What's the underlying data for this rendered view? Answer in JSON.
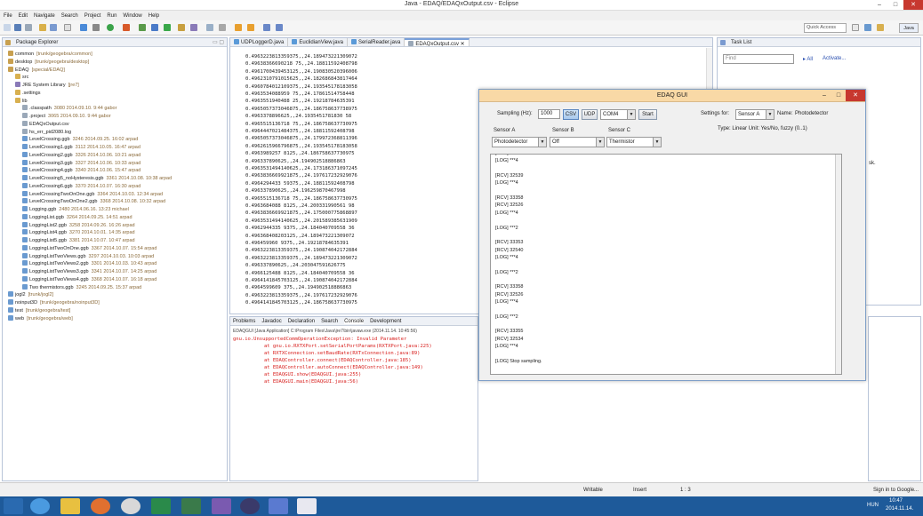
{
  "window": {
    "title": "Java - EDAQ/EDAQxOutput.csv - Eclipse"
  },
  "menu": [
    "File",
    "Edit",
    "Navigate",
    "Search",
    "Project",
    "Run",
    "Window",
    "Help"
  ],
  "quick_access": "Quick Access",
  "perspective": "Java",
  "explorer": {
    "title": "Package Explorer",
    "items": [
      {
        "label": "common",
        "meta": "[trunk/geogebra/common]"
      },
      {
        "label": "desktop",
        "meta": "[trunk/geogebra/desktop]"
      },
      {
        "label": "EDAQ",
        "meta": "[special/EDAQ]"
      },
      {
        "label": "src",
        "meta": ""
      },
      {
        "label": "JRE System Library",
        "meta": "[jre7]"
      },
      {
        "label": ".settings",
        "meta": ""
      },
      {
        "label": "lib",
        "meta": ""
      },
      {
        "label": ".classpath",
        "meta": "3080  2014.09.10. 9:44  gabor"
      },
      {
        "label": ".project",
        "meta": "3065  2014.09.10. 9:44  gabor"
      },
      {
        "label": "EDAQxOutput.csv",
        "meta": ""
      },
      {
        "label": "hs_err_pid2080.log",
        "meta": ""
      },
      {
        "label": "LevelCrossing.ggb",
        "meta": "3246  2014.09.25. 16:02  arpad"
      },
      {
        "label": "LevelCrossing1.ggb",
        "meta": "3112  2014.10.05. 16:47  arpad"
      },
      {
        "label": "LevelCrossing2.ggb",
        "meta": "3326  2014.10.06. 10:21  arpad"
      },
      {
        "label": "LevelCrossing3.ggb",
        "meta": "3327  2014.10.06. 10:33  arpad"
      },
      {
        "label": "LevelCrossing4.ggb",
        "meta": "3340  2014.10.06. 15:47  arpad"
      },
      {
        "label": "LevelCrossing5_noHysteresis.ggb",
        "meta": "3361  2014.10.08. 10:38  arpad"
      },
      {
        "label": "LevelCrossing6.ggb",
        "meta": "3370  2014.10.07. 16:30  arpad"
      },
      {
        "label": "LevelCrossingTwoOnOne.ggb",
        "meta": "3364  2014.10.03. 12:34  arpad"
      },
      {
        "label": "LevelCrossingTwoOnOne2.ggb",
        "meta": "3368  2014.10.08. 10:32  arpad"
      },
      {
        "label": "Logging.ggb",
        "meta": "2480  2014.06.16. 13:23  michael"
      },
      {
        "label": "LoggingList.ggb",
        "meta": "3264  2014.09.25. 14:51  arpad"
      },
      {
        "label": "LoggingList2.ggb",
        "meta": "3258  2014.09.26. 16:26  arpad"
      },
      {
        "label": "LoggingList4.ggb",
        "meta": "3270  2014.10.01. 14:35  arpad"
      },
      {
        "label": "LoggingList5.ggb",
        "meta": "3381  2014.10.07. 10:47  arpad"
      },
      {
        "label": "LoggingListTwoOnOne.ggb",
        "meta": "3367  2014.10.07. 15:54  arpad"
      },
      {
        "label": "LoggingListTwoViews.ggb",
        "meta": "3297  2014.10.03. 10:03  arpad"
      },
      {
        "label": "LoggingListTwoViews2.ggb",
        "meta": "3301  2014.10.03. 10:43  arpad"
      },
      {
        "label": "LoggingListTwoViews3.ggb",
        "meta": "3341  2014.10.07. 14:25  arpad"
      },
      {
        "label": "LoggingListTwoViews4.ggb",
        "meta": "3368  2014.10.07. 16:18  arpad"
      },
      {
        "label": "Two thermistors.ggb",
        "meta": "3245  2014.09.25. 15:37  arpad"
      },
      {
        "label": "jogl2",
        "meta": "[trunk/jogl2]"
      },
      {
        "label": "noinput3D",
        "meta": "[trunk/geogebra/noinput3D]"
      },
      {
        "label": "test",
        "meta": "[trunk/geogebra/test]"
      },
      {
        "label": "web",
        "meta": "[trunk/geogebra/web]"
      }
    ]
  },
  "editor": {
    "tabs": [
      "UDPLoggerD.java",
      "EuclidianView.java",
      "SerialReader.java",
      "EDAQxOutput.csv"
    ],
    "lines": [
      "0.4963223813359375,,24.189473221309072",
      "0.49638366690218 75,,24.18811592408798",
      "0.4961700439453125,,24.190830520396006",
      "0.4962310791015625,,24.182686843817464",
      "0.4960784012109375,,24.193545178183058",
      "0.4963534088959 75,,24.17861514758448",
      "0.4963551940488 25,,24.19218784635391",
      "0.4965057373046875,,24.186758637738975",
      "0.4963378896625,,24.1935451781830 58",
      "0.4965515136718 75,,24.186758637730975",
      "0.4964447021484375,,24.18811592408798",
      "0.4965057373046875,,24.179972368811396",
      "0.4962615966796875,,24.193545178183058",
      "0.4963989257 8125,,24.186758637730975",
      "0.496337890625,,24.194902518886863",
      "0.4963531494140625,,24.173186371097245",
      "0.4963836669921875,,24.197617232929076",
      "0.4964294433 59375,,24.18811592408798",
      "0.496337890625,,24.196259870467998",
      "0.4965515136718 75,,24.186758637730975",
      "0.4963684088 8125,,24.200331990561 98",
      "0.4963836669921875,,24.175000775868897",
      "0.4963531494140625,,24.201589385631909",
      "0.4962944335 9375,,24.184040709558 36",
      "0.496368408203125,,24.189473221309072",
      "0.496459960 9375,,24.19218784635391",
      "0.4963223813359375,,24.190874042172884",
      "0.4963223813359375,,24.189473221309072",
      "0.496337890625,,24.203047591626775",
      "0.4966125488 8125,,24.184040709558 36",
      "0.4964141845703125,,24.190874042172884",
      "0.4964599609 375,,24.194902518886863",
      "0.4963223813359375,,24.197617232929076",
      "0.4964141845703125,,24.186758637730975"
    ]
  },
  "right_panel": {
    "title": "Task List",
    "find_placeholder": "Find",
    "all_label": "All",
    "activate_label": "Activate...",
    "partial": "sk."
  },
  "bottom": {
    "tabs": [
      "Problems",
      "Javadoc",
      "Declaration",
      "Search",
      "Console",
      "Development"
    ],
    "console_header": "EDAQGUI [Java Application] C:\\Program Files\\Java\\jre7\\bin\\javaw.exe (2014.11.14. 10:45:56)",
    "exception": "gnu.io.UnsupportedCommOperationException: Invalid Parameter",
    "stack": [
      "at gnu.io.RXTXPort.setSerialPortParams(RXTXPort.java:225)",
      "at RXTXConnection.setBaudRate(RXTxConnection.java:89)",
      "at EDAQController.connect(EDAQController.java:185)",
      "at EDAQController.autoConnect(EDAQController.java:149)",
      "at EDAQGUI.show(EDAQGUI.java:255)",
      "at EDAQGUI.main(EDAQGUI.java:56)"
    ]
  },
  "gui": {
    "title": "EDAQ GUI",
    "sampling_label": "Sampling (Hz):",
    "sampling_value": "1000",
    "csv": "CSV",
    "udp": "UDP",
    "port": "COM4",
    "start": "Start",
    "settings_for_label": "Settings for:",
    "settings_for_value": "Sensor A",
    "name_label": "Name:",
    "name_value": "Photodetector",
    "type_line": "Type:  Linear  Unit:  Yes/No, fuzzy (0..1)",
    "sensors": [
      {
        "label": "Sensor A",
        "value": "Photodetector"
      },
      {
        "label": "Sensor B",
        "value": "Off"
      },
      {
        "label": "Sensor C",
        "value": "Thermistor"
      }
    ],
    "log": [
      "[RCV] 33348",
      "[LOG] ***4",
      "",
      "[RCV] 32539",
      "[LOG] ***4",
      "",
      "[RCV] 33358",
      "[RCV] 32526",
      "[LOG] ***4",
      "",
      "[LOG] ***2",
      "",
      "[RCV] 33353",
      "[RCV] 32540",
      "[LOG] ***4",
      "",
      "[LOG] ***2",
      "",
      "[RCV] 33358",
      "[RCV] 32526",
      "[LOG] ***4",
      "",
      "[LOG] ***2",
      "",
      "[RCV] 33355",
      "[RCV] 32534",
      "[LOG] ***4",
      "",
      "[LOG] Stop sampling."
    ]
  },
  "status": {
    "writable": "Writable",
    "insert": "Insert",
    "position": "1 : 3",
    "signin": "Sign in to Google..."
  },
  "clock": {
    "time": "10:47",
    "date": "2014.11.14.",
    "lang": "HUN"
  },
  "colors": {
    "accent": "#7aa0d8",
    "gui_title": "#f9d9a6",
    "taskbar": "#1e5a9a",
    "error": "#d8201e",
    "link": "#2a4fb0"
  }
}
